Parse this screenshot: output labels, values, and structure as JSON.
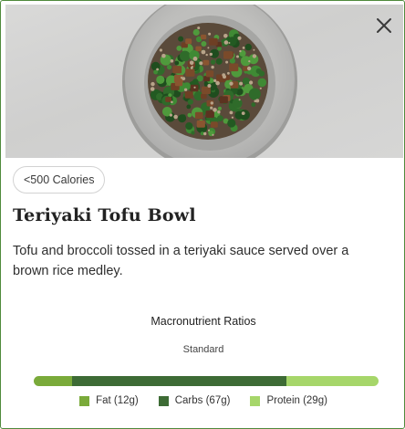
{
  "badge": {
    "label": "<500 Calories"
  },
  "meal": {
    "title": "Teriyaki Tofu Bowl",
    "description": "Tofu and broccoli tossed in a teriyaki sauce served over a brown rice medley."
  },
  "macros": {
    "title": "Macronutrient Ratios",
    "subtitle": "Standard",
    "items": [
      {
        "label": "Fat (12g)",
        "grams": 12,
        "color": "#7aaa3a"
      },
      {
        "label": "Carbs (67g)",
        "grams": 67,
        "color": "#3d6b35"
      },
      {
        "label": "Protein (29g)",
        "grams": 29,
        "color": "#a6d66a"
      }
    ]
  },
  "icons": {
    "close": "close-icon",
    "hero": "meal-photo"
  },
  "colors": {
    "border": "#4f8a3c"
  }
}
